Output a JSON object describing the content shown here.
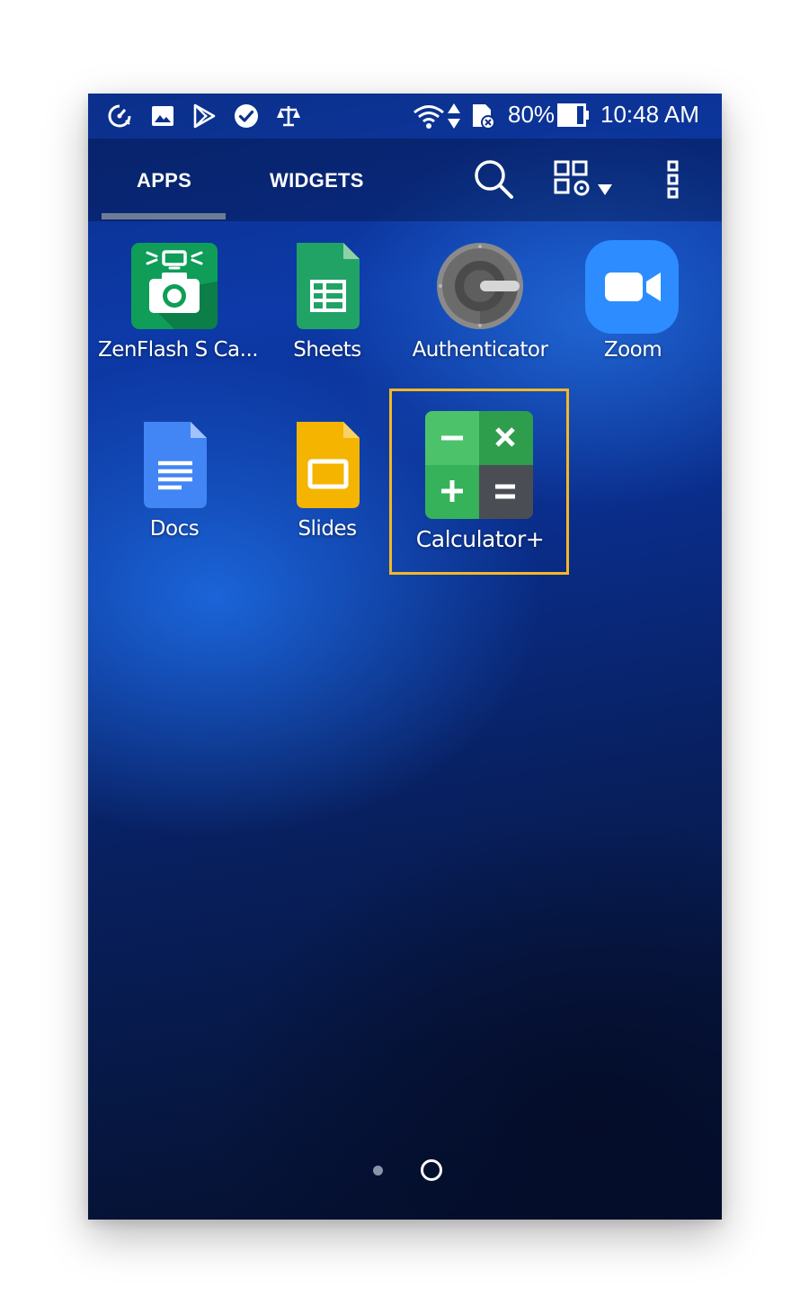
{
  "status_bar": {
    "icons": [
      "data-saver-icon",
      "image-icon",
      "play-store-icon",
      "check-circle-icon",
      "scale-icon",
      "wifi-icon",
      "data-arrows-icon",
      "no-sd-card-icon",
      "battery-icon"
    ],
    "battery_percent": "80%",
    "time": "10:48 AM"
  },
  "tabs": {
    "apps": "APPS",
    "widgets": "WIDGETS",
    "active": "APPS"
  },
  "toolbar": {
    "icons": [
      "search-icon",
      "grid-settings-icon",
      "dropdown-arrow-icon",
      "more-options-icon"
    ]
  },
  "apps": [
    {
      "label": "ZenFlash S Ca...",
      "icon": "zenflash-camera-icon"
    },
    {
      "label": "Sheets",
      "icon": "sheets-icon"
    },
    {
      "label": "Authenticator",
      "icon": "authenticator-icon"
    },
    {
      "label": "Zoom",
      "icon": "zoom-icon"
    },
    {
      "label": "Docs",
      "icon": "docs-icon"
    },
    {
      "label": "Slides",
      "icon": "slides-icon"
    },
    {
      "label": "Calculator+",
      "icon": "calculator-icon",
      "highlighted": true
    }
  ],
  "pagination": {
    "total_pages": 2,
    "current_page": 2
  },
  "colors": {
    "highlight_border": "#f4b826",
    "sheets_green": "#21a366",
    "slides_yellow": "#f4b400",
    "docs_blue": "#4285f4",
    "zoom_blue": "#2d8cff",
    "zenflash_green": "#0f9d58"
  }
}
